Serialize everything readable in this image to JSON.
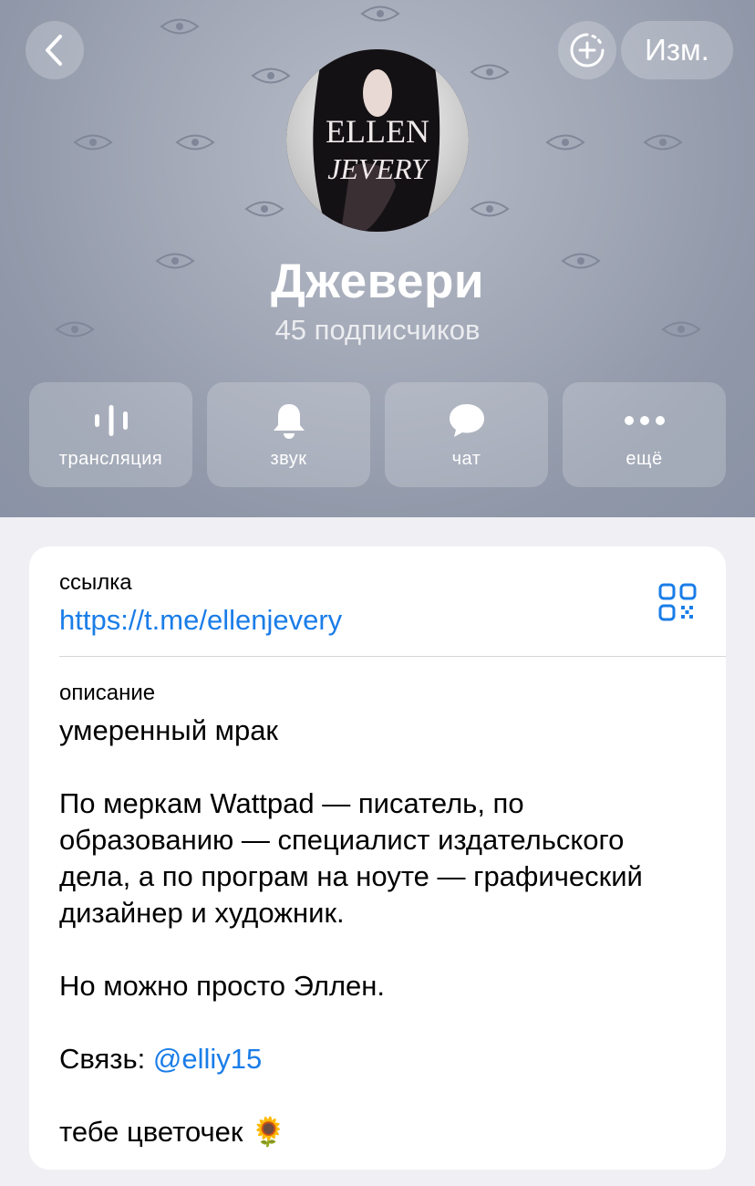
{
  "header": {
    "edit_label": "Изм.",
    "channel_name": "Джевери",
    "subscribers": "45 подписчиков",
    "avatar_text_line1": "ELLEN",
    "avatar_text_line2": "JEVERY"
  },
  "actions": [
    {
      "label": "трансляция",
      "icon": "broadcast-icon"
    },
    {
      "label": "звук",
      "icon": "bell-icon"
    },
    {
      "label": "чат",
      "icon": "chat-bubble-icon"
    },
    {
      "label": "ещё",
      "icon": "more-dots-icon"
    }
  ],
  "info": {
    "link_label": "ссылка",
    "link_value": "https://t.me/ellenjevery",
    "description_label": "описание",
    "description": {
      "line1": "умеренный мрак",
      "para2_l1": "По меркам Wattpad — писатель, по",
      "para2_l2": "образованию — специалист издательского",
      "para2_l3": "дела, а по програм на ноуте — графический",
      "para2_l4": "дизайнер и художник.",
      "para3": "Но можно просто Эллен.",
      "contact_prefix": "Связь: ",
      "contact_handle": "@elliy15",
      "closing": "тебе цветочек 🌻"
    }
  },
  "colors": {
    "accent": "#1a7de8",
    "header_bg": "#9aa1b1",
    "page_bg": "#efeff4"
  }
}
